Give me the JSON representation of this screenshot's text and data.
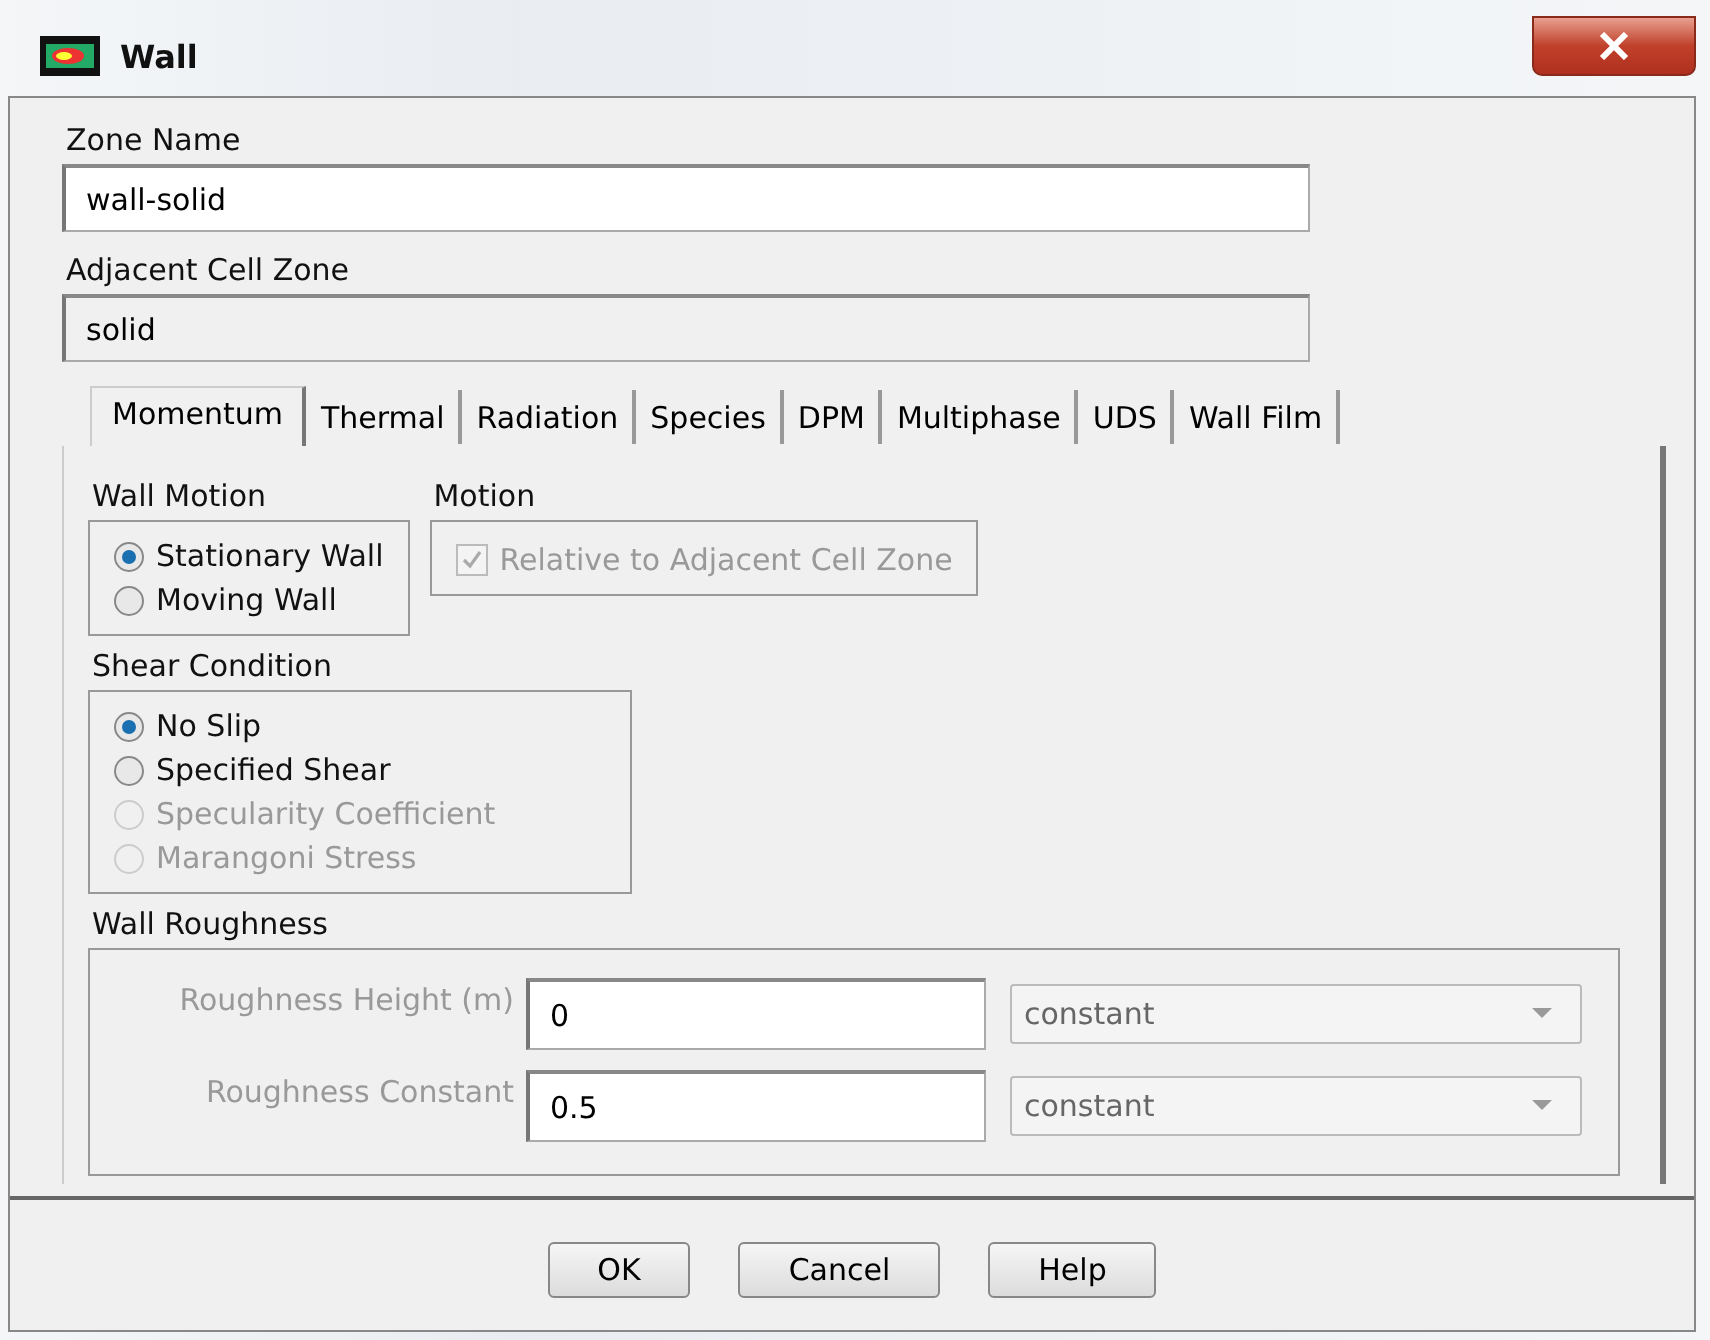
{
  "window": {
    "title": "Wall"
  },
  "zone_name": {
    "label": "Zone Name",
    "value": "wall-solid",
    "disabled": false
  },
  "adjacent_cell_zone": {
    "label": "Adjacent Cell Zone",
    "value": "solid",
    "disabled": true
  },
  "tabs": [
    {
      "label": "Momentum",
      "selected": true
    },
    {
      "label": "Thermal",
      "selected": false
    },
    {
      "label": "Radiation",
      "selected": false
    },
    {
      "label": "Species",
      "selected": false
    },
    {
      "label": "DPM",
      "selected": false
    },
    {
      "label": "Multiphase",
      "selected": false
    },
    {
      "label": "UDS",
      "selected": false
    },
    {
      "label": "Wall Film",
      "selected": false
    }
  ],
  "wall_motion": {
    "title": "Wall Motion",
    "options": [
      {
        "label": "Stationary Wall",
        "selected": true,
        "disabled": false
      },
      {
        "label": "Moving Wall",
        "selected": false,
        "disabled": false
      }
    ]
  },
  "motion": {
    "title": "Motion",
    "checkbox": {
      "label": "Relative to Adjacent Cell Zone",
      "checked": true,
      "disabled": true
    }
  },
  "shear_condition": {
    "title": "Shear Condition",
    "options": [
      {
        "label": "No Slip",
        "selected": true,
        "disabled": false
      },
      {
        "label": "Specified Shear",
        "selected": false,
        "disabled": false
      },
      {
        "label": "Specularity Coefficient",
        "selected": false,
        "disabled": true
      },
      {
        "label": "Marangoni Stress",
        "selected": false,
        "disabled": true
      }
    ]
  },
  "wall_roughness": {
    "title": "Wall Roughness",
    "rows": [
      {
        "label": "Roughness Height (m)",
        "value": "0",
        "method": "constant"
      },
      {
        "label": "Roughness Constant",
        "value": "0.5",
        "method": "constant"
      }
    ]
  },
  "buttons": [
    "OK",
    "Cancel",
    "Help"
  ]
}
